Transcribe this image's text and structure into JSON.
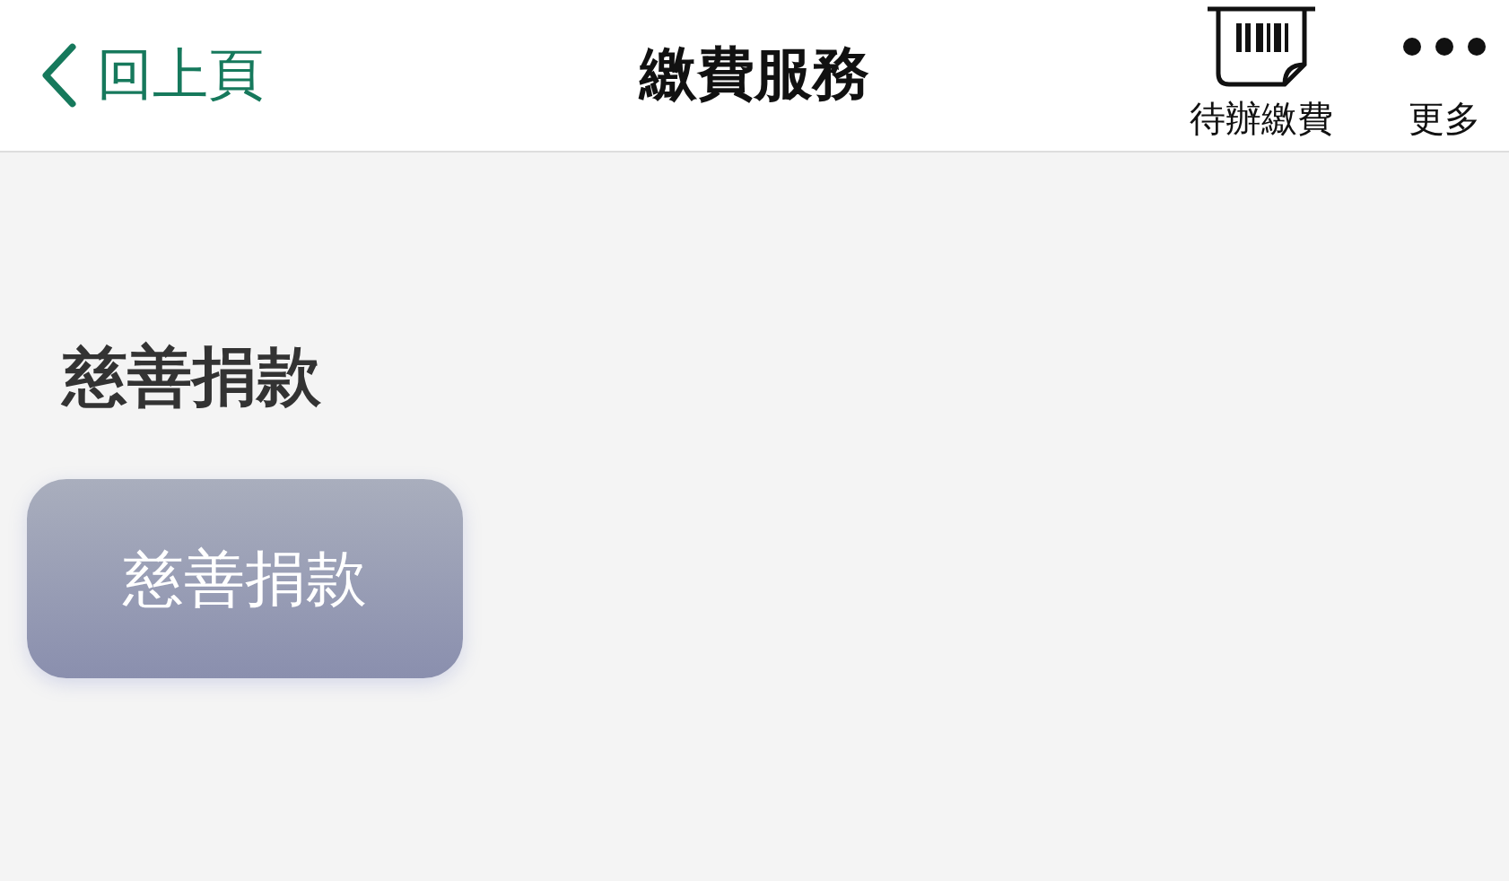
{
  "header": {
    "back_label": "回上頁",
    "title": "繳費服務",
    "actions": [
      {
        "kind": "barcode",
        "label": "待辦繳費"
      },
      {
        "kind": "more",
        "label": "更多"
      }
    ]
  },
  "sections": [
    {
      "title": "慈善捐款",
      "buttons": [
        "慈善捐款"
      ]
    }
  ]
}
